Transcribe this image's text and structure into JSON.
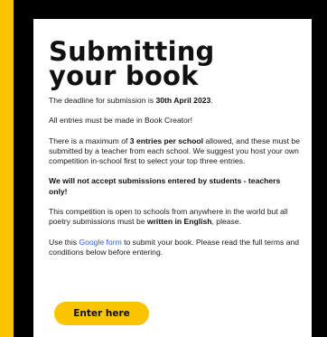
{
  "page": {
    "title": "Submitting your book",
    "deadline": {
      "prefix": "The deadline for submission is ",
      "date": "30th April 2023",
      "suffix": "."
    },
    "book_creator": "All entries must be made in Book Creator!",
    "entries": {
      "prefix": "There is a maximum of ",
      "bold": "3 entries per school",
      "suffix": " allowed, and these must be submitted by a teacher from each school. We suggest you host your own competition in-school first to select your top three entries."
    },
    "warning": "We will not accept submissions entered by students - teachers only!",
    "english": {
      "prefix": "This competition is open to schools from anywhere in the world but all poetry submissions must be ",
      "bold": "written in English",
      "suffix": ", please."
    },
    "form": {
      "prefix": "Use this ",
      "link": "Google form",
      "suffix": " to submit your book. Please read the full terms and conditions below before entering."
    },
    "cta_label": "Enter here"
  },
  "colors": {
    "background": "#f9c400",
    "frame": "#000000",
    "accent": "#f9c400",
    "link": "#2563eb"
  }
}
